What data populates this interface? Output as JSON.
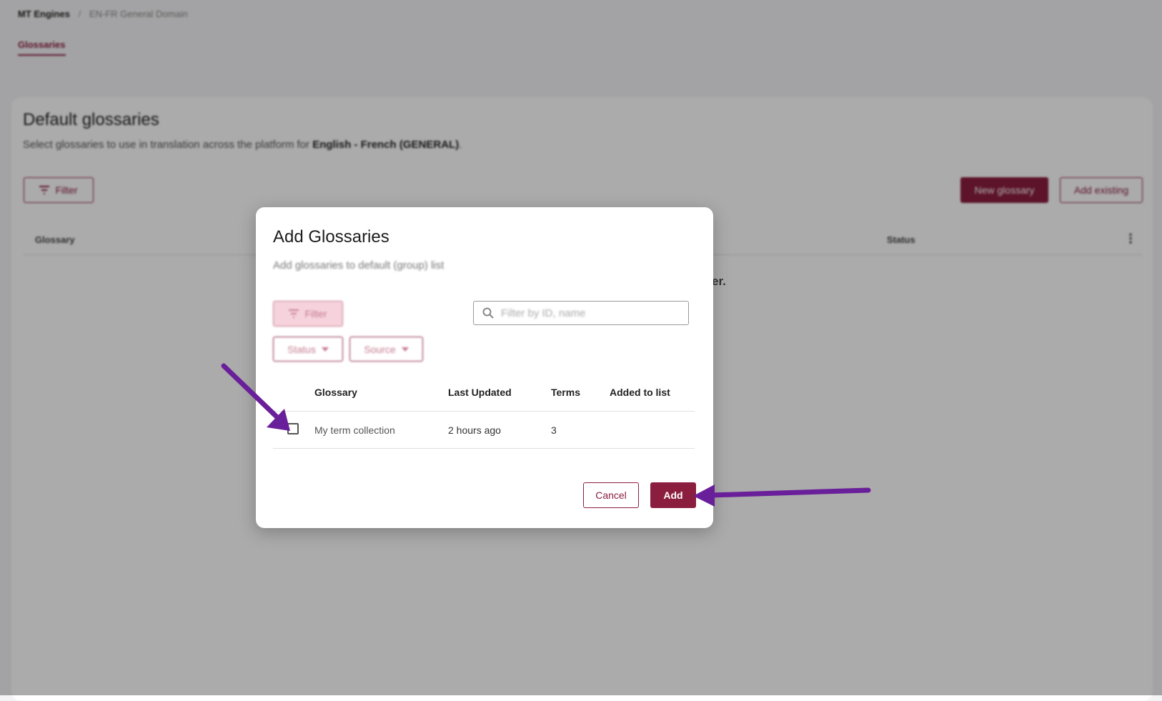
{
  "breadcrumb": {
    "root": "MT Engines",
    "separator": "/",
    "current": "EN-FR General Domain"
  },
  "tabs": [
    {
      "label": "Glossaries",
      "active": true
    }
  ],
  "page": {
    "title": "Default glossaries",
    "subtitle_prefix": "Select glossaries to use in translation across the platform for",
    "subtitle_strong": "English - French (GENERAL)",
    "subtitle_suffix": ".",
    "filter_label": "Filter",
    "new_glossary_label": "New glossary",
    "add_existing_label": "Add existing",
    "table_headers": {
      "glossary": "Glossary",
      "status": "Status"
    },
    "empty_text_visible_fragment": "nter."
  },
  "modal": {
    "title": "Add Glossaries",
    "subtitle": "Add glossaries to default (group) list",
    "filter_label": "Filter",
    "search": {
      "placeholder": "Filter by ID, name",
      "value": ""
    },
    "status_dropdown": "Status",
    "source_dropdown": "Source",
    "columns": {
      "glossary": "Glossary",
      "last_updated": "Last Updated",
      "terms": "Terms",
      "added_to_list": "Added to list"
    },
    "rows": [
      {
        "name": "My term collection",
        "last_updated": "2 hours ago",
        "terms": "3",
        "added_to_list": "",
        "checked": false
      }
    ],
    "cancel_label": "Cancel",
    "add_label": "Add"
  },
  "colors": {
    "brand": "#8b1e3f",
    "annotation_arrow": "#6a1f9a",
    "overlay": "rgba(0,0,0,0.33)"
  },
  "icons": {
    "filter": "filter-icon",
    "search": "search-icon",
    "chevron": "chevron-down-icon",
    "kebab": "kebab-menu-icon"
  }
}
